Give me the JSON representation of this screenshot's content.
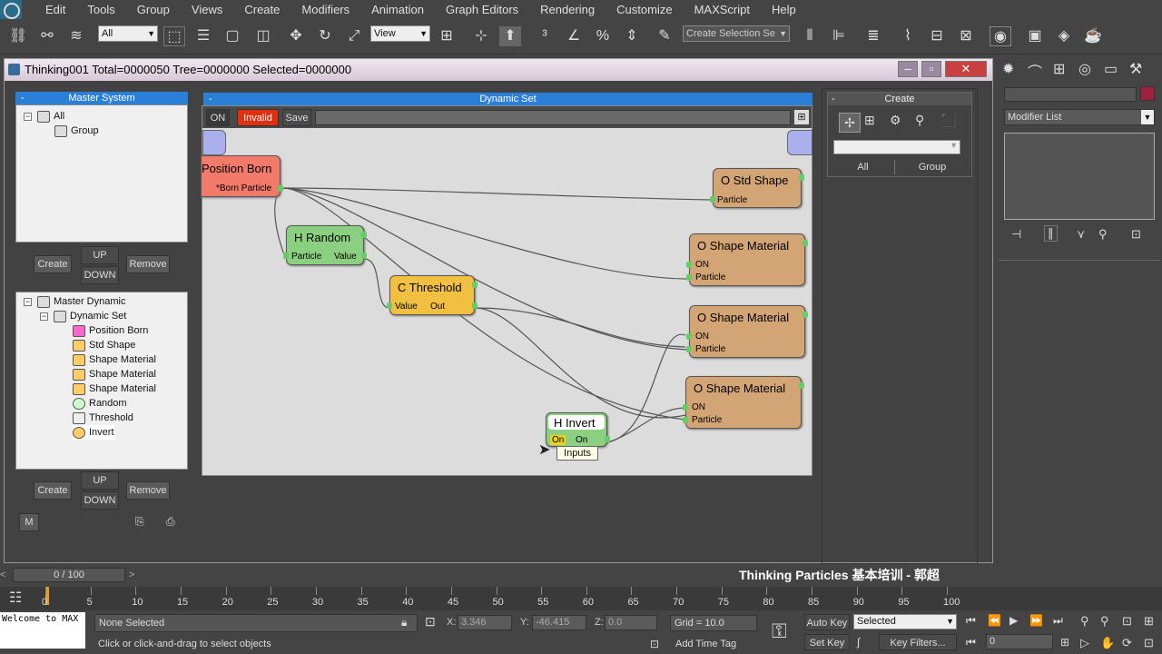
{
  "menu": [
    "Edit",
    "Tools",
    "Group",
    "Views",
    "Create",
    "Modifiers",
    "Animation",
    "Graph Editors",
    "Rendering",
    "Customize",
    "MAXScript",
    "Help"
  ],
  "toolbar": {
    "selection_filter": "All",
    "reference_coord": "View",
    "named_selection_placeholder": "Create Selection Se"
  },
  "dialog": {
    "title": "Thinking001  Total=0000050  Tree=0000000  Selected=0000000"
  },
  "master_system": {
    "header": "Master System",
    "tree": [
      {
        "label": "All",
        "level": 0
      },
      {
        "label": "Group",
        "level": 1
      }
    ],
    "create_label": "Create",
    "up_label": "UP",
    "down_label": "DOWN",
    "remove_label": "Remove"
  },
  "master_dynamic": {
    "tree": [
      {
        "label": "Master Dynamic",
        "level": 0
      },
      {
        "label": "Dynamic Set",
        "level": 1
      },
      {
        "label": "Position Born",
        "level": 2
      },
      {
        "label": "Std Shape",
        "level": 2
      },
      {
        "label": "Shape Material",
        "level": 2
      },
      {
        "label": "Shape Material",
        "level": 2
      },
      {
        "label": "Shape Material",
        "level": 2
      },
      {
        "label": "Random",
        "level": 2
      },
      {
        "label": "Threshold",
        "level": 2
      },
      {
        "label": "Invert",
        "level": 2
      }
    ],
    "create_label": "Create",
    "up_label": "UP",
    "down_label": "DOWN",
    "remove_label": "Remove",
    "m_label": "M"
  },
  "dynamic_set": {
    "header": "Dynamic Set",
    "on_label": "ON",
    "invalid_label": "Invalid",
    "save_label": "Save",
    "nodes": {
      "position_born": {
        "title": "Position Born",
        "port": "*Born Particle"
      },
      "std_shape": {
        "title": "O Std Shape",
        "port": "Particle"
      },
      "random": {
        "title": "H Random",
        "port1": "Particle",
        "port2": "Value"
      },
      "threshold": {
        "title": "C Threshold",
        "port1": "Value",
        "port2": "Out"
      },
      "shape_mat1": {
        "title": "O Shape Material",
        "port1": "ON",
        "port2": "Particle"
      },
      "shape_mat2": {
        "title": "O Shape Material",
        "port1": "ON",
        "port2": "Particle"
      },
      "shape_mat3": {
        "title": "O Shape Material",
        "port1": "ON",
        "port2": "Particle"
      },
      "invert": {
        "title": "H Invert",
        "port1": "On",
        "port2": "On"
      }
    },
    "tooltip": "Inputs"
  },
  "create_panel": {
    "header": "Create",
    "all_label": "All",
    "group_label": "Group"
  },
  "command_panel": {
    "modifier_list": "Modifier List"
  },
  "timeline": {
    "frame": "0 / 100",
    "ticks": [
      "0",
      "5",
      "10",
      "15",
      "20",
      "25",
      "30",
      "35",
      "40",
      "45",
      "50",
      "55",
      "60",
      "65",
      "70",
      "75",
      "80",
      "85",
      "90",
      "95",
      "100"
    ],
    "watermark": "Thinking Particles 基本培训 - 郭超"
  },
  "status": {
    "welcome": "Welcome to MAX",
    "selection": "None Selected",
    "hint": "Click or click-and-drag to select objects",
    "x_label": "X:",
    "x_value": "3.346",
    "y_label": "Y:",
    "y_value": "-46.415",
    "z_label": "Z:",
    "z_value": "0.0",
    "grid": "Grid = 10.0",
    "add_time_tag": "Add Time Tag",
    "auto_key": "Auto Key",
    "set_key": "Set Key",
    "selected_dropdown": "Selected",
    "key_filters": "Key Filters...",
    "frame_field": "0"
  }
}
